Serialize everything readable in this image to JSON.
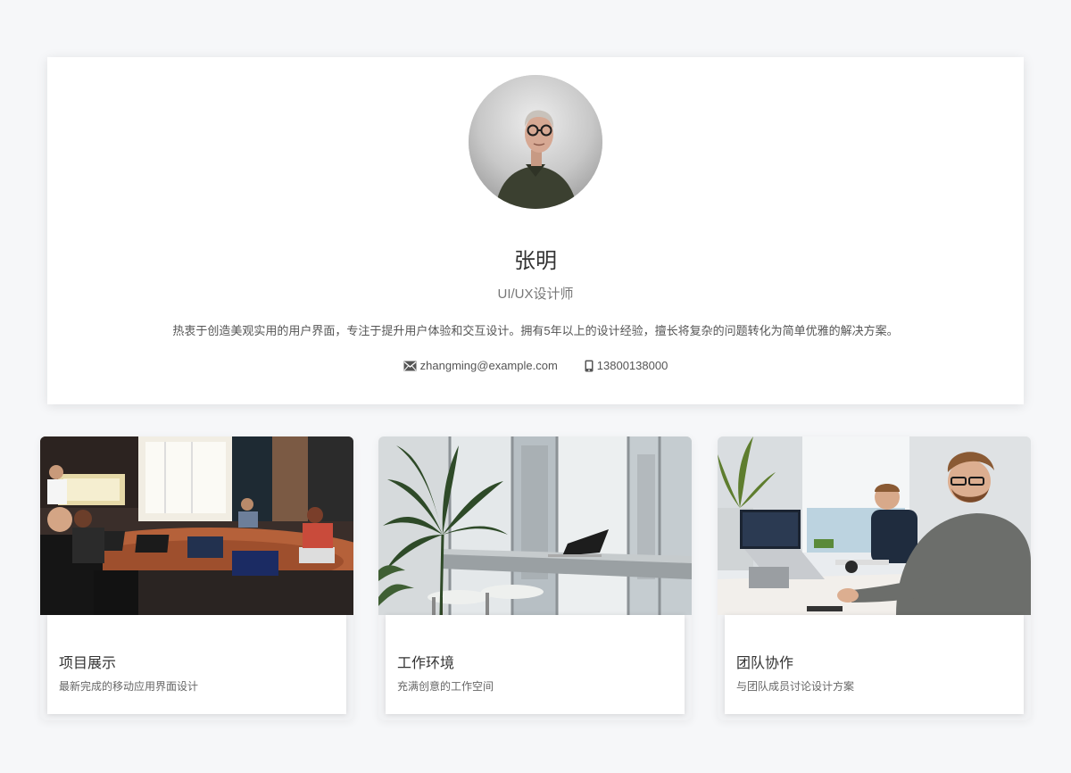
{
  "profile": {
    "name": "张明",
    "role": "UI/UX设计师",
    "bio": "热衷于创造美观实用的用户界面，专注于提升用户体验和交互设计。拥有5年以上的设计经验，擅长将复杂的问题转化为简单优雅的解决方案。",
    "email": "zhangming@example.com",
    "phone": "13800138000",
    "email_icon": "mail-icon",
    "phone_icon": "phone-icon"
  },
  "gallery": [
    {
      "title": "项目展示",
      "description": "最新完成的移动应用界面设计"
    },
    {
      "title": "工作环境",
      "description": "充满创意的工作空间"
    },
    {
      "title": "团队协作",
      "description": "与团队成员讨论设计方案"
    }
  ],
  "colors": {
    "background": "#f6f7f9",
    "card": "#ffffff",
    "text_primary": "#333333",
    "text_secondary": "#777777"
  }
}
